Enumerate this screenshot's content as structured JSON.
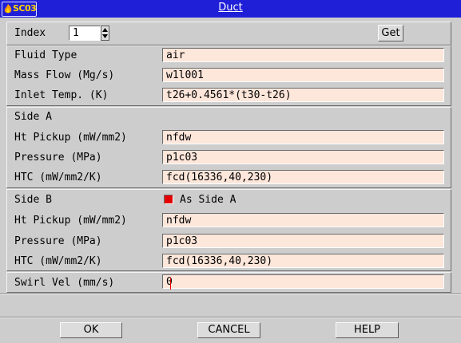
{
  "window": {
    "title": "Duct",
    "app_icon_label": "SC03"
  },
  "index": {
    "label": "Index",
    "value": "1",
    "get_label": "Get"
  },
  "general": {
    "fluid_type": {
      "label": "Fluid Type",
      "value": "air"
    },
    "mass_flow": {
      "label": "Mass Flow (Mg/s)",
      "value": "w1l001"
    },
    "inlet_temp": {
      "label": "Inlet Temp. (K)",
      "value": "t26+0.4561*(t30-t26)"
    }
  },
  "side_a": {
    "heading": "Side A",
    "ht_pickup": {
      "label": "Ht Pickup (mW/mm2)",
      "value": "nfdw"
    },
    "pressure": {
      "label": "Pressure (MPa)",
      "value": "p1c03"
    },
    "htc": {
      "label": "HTC (mW/mm2/K)",
      "value": "fcd(16336,40,230)"
    }
  },
  "side_b": {
    "heading": "Side B",
    "as_side_a_label": "As Side A",
    "as_side_a_checked": true,
    "ht_pickup": {
      "label": "Ht Pickup (mW/mm2)",
      "value": "nfdw"
    },
    "pressure": {
      "label": "Pressure (MPa)",
      "value": "p1c03"
    },
    "htc": {
      "label": "HTC (mW/mm2/K)",
      "value": "fcd(16336,40,230)"
    }
  },
  "swirl": {
    "label": "Swirl Vel (mm/s)",
    "value": "0"
  },
  "buttons": {
    "ok": "OK",
    "cancel": "CANCEL",
    "help": "HELP"
  },
  "colors": {
    "titlebar": "#1f1fd8",
    "field_bg": "#fde6da",
    "check_red": "#e40000",
    "dialog_bg": "#cdcdcd"
  }
}
